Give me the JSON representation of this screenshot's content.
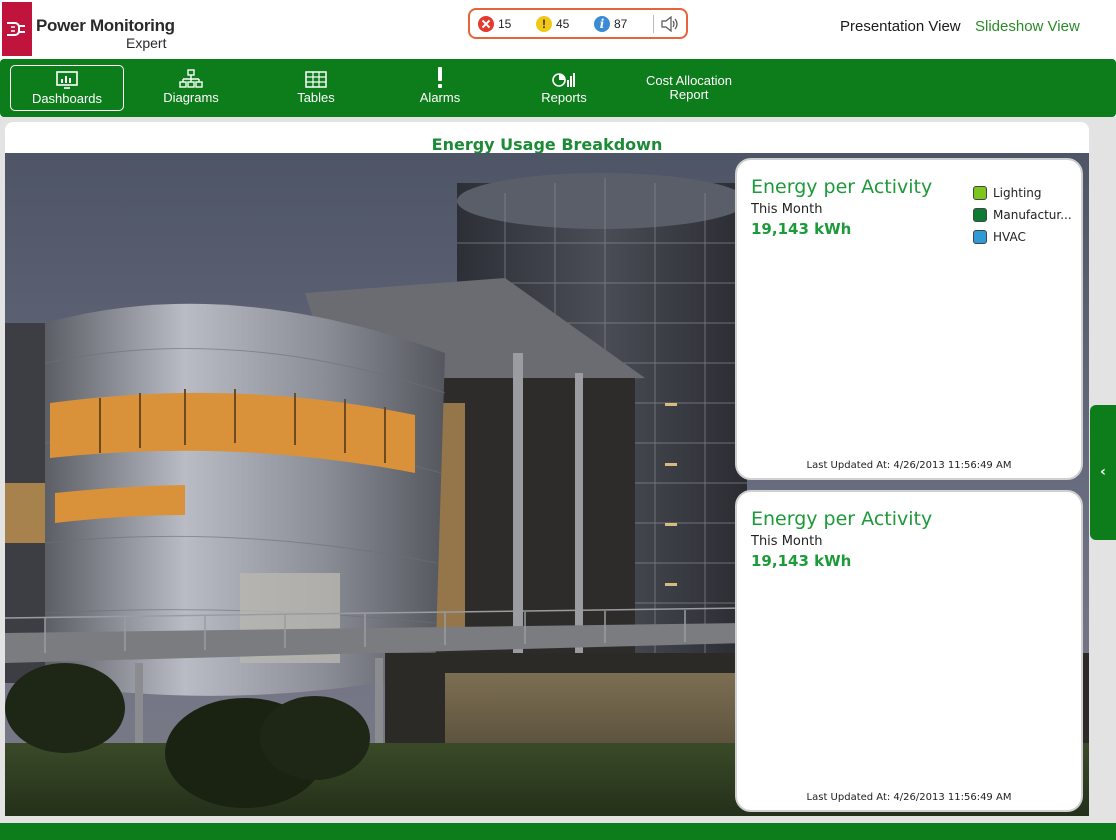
{
  "app": {
    "logo_line1": "Power Monitoring",
    "logo_line2": "Expert",
    "brand_color": "#c0143c",
    "accent_color": "#0d7d1c"
  },
  "alarms": {
    "errors": "15",
    "warnings": "45",
    "info": "87",
    "sound_icon": "speaker-icon"
  },
  "views": {
    "presentation": "Presentation View",
    "slideshow": "Slideshow View"
  },
  "nav": {
    "items": [
      {
        "label": "Dashboards",
        "icon": "dashboard-icon",
        "active": true
      },
      {
        "label": "Diagrams",
        "icon": "diagram-icon",
        "active": false
      },
      {
        "label": "Tables",
        "icon": "table-icon",
        "active": false
      },
      {
        "label": "Alarms",
        "icon": "alarm-icon",
        "active": false
      },
      {
        "label": "Reports",
        "icon": "reports-icon",
        "active": false
      },
      {
        "label_line1": "Cost Allocation",
        "label_line2": "Report",
        "active": false
      }
    ]
  },
  "dashboard": {
    "title": "Energy Usage Breakdown",
    "cards": [
      {
        "title": "Energy per Activity",
        "period": "This Month",
        "value": "19,143 kWh",
        "updated": "Last Updated At: 4/26/2013 11:56:49 AM",
        "legend": [
          {
            "label": "Lighting",
            "color": "#7dc61e"
          },
          {
            "label": "Manufactur...",
            "color": "#0f7a33"
          },
          {
            "label": "HVAC",
            "color": "#2e9ad6"
          }
        ]
      },
      {
        "title": "Energy per Activity",
        "period": "This Month",
        "value": "19,143 kWh",
        "updated": "Last Updated At: 4/26/2013 11:56:49 AM"
      }
    ]
  },
  "side_tab": {
    "glyph": "‹"
  }
}
